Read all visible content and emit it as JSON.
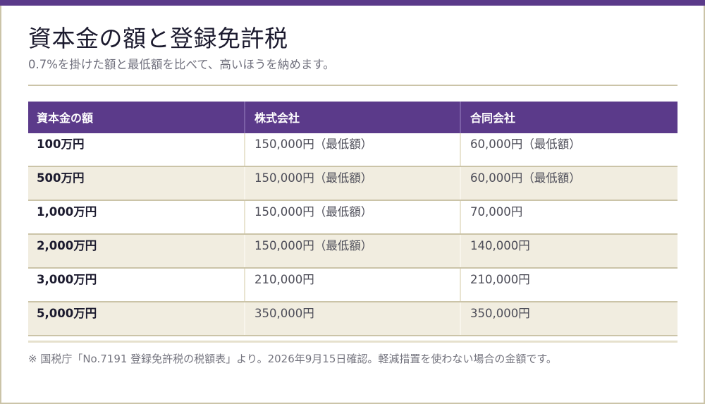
{
  "colors": {
    "accent": "#5b3a8a",
    "rule": "#cbc4a8",
    "row_shade": "#f1ede0"
  },
  "header": {
    "title": "資本金の額と登録免許税",
    "subtitle": "0.7%を掛けた額と最低額を比べて、高いほうを納めます。"
  },
  "table": {
    "columns": [
      "資本金の額",
      "株式会社",
      "合同会社"
    ],
    "rows": [
      {
        "capital": "100万円",
        "kabushiki": "150,000円（最低額）",
        "godo": "60,000円（最低額）"
      },
      {
        "capital": "500万円",
        "kabushiki": "150,000円（最低額）",
        "godo": "60,000円（最低額）"
      },
      {
        "capital": "1,000万円",
        "kabushiki": "150,000円（最低額）",
        "godo": "70,000円"
      },
      {
        "capital": "2,000万円",
        "kabushiki": "150,000円（最低額）",
        "godo": "140,000円"
      },
      {
        "capital": "3,000万円",
        "kabushiki": "210,000円",
        "godo": "210,000円"
      },
      {
        "capital": "5,000万円",
        "kabushiki": "350,000円",
        "godo": "350,000円"
      }
    ]
  },
  "footer": {
    "note": "※ 国税庁「No.7191 登録免許税の税額表」より。2026年9月15日確認。軽減措置を使わない場合の金額です。"
  }
}
